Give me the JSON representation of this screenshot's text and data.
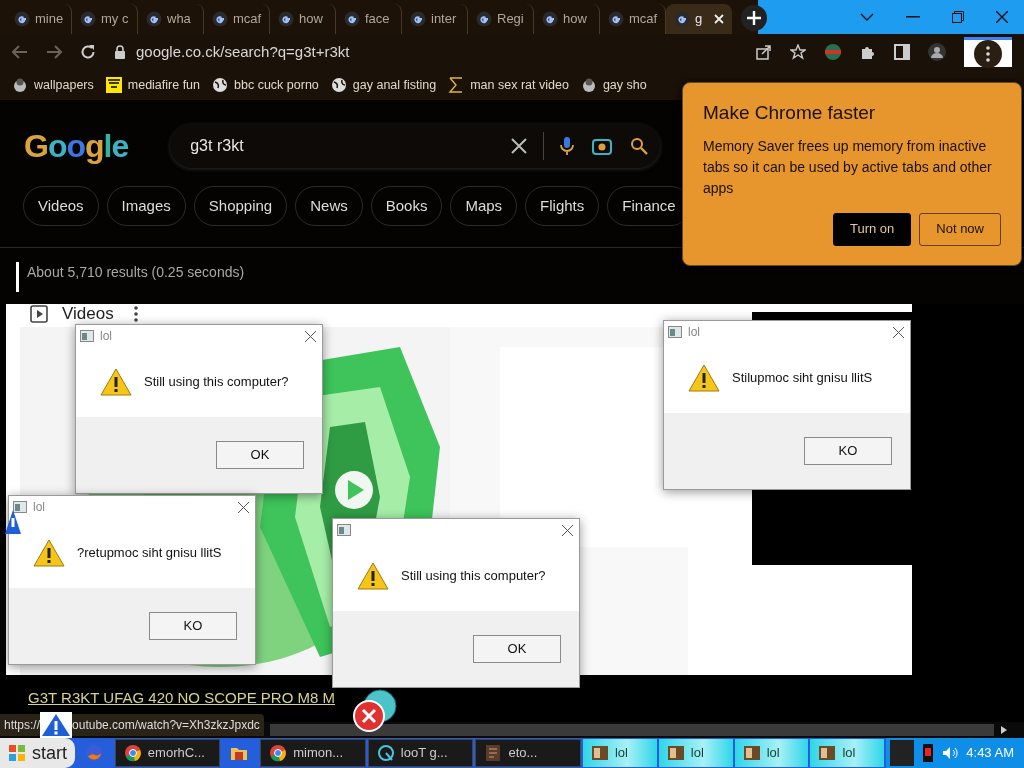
{
  "tabs": [
    {
      "label": "mine",
      "selected": false
    },
    {
      "label": "my c",
      "selected": false
    },
    {
      "label": "wha",
      "selected": false
    },
    {
      "label": "mcaf",
      "selected": false
    },
    {
      "label": "how",
      "selected": false
    },
    {
      "label": "face",
      "selected": false
    },
    {
      "label": "inter",
      "selected": false
    },
    {
      "label": "Regi",
      "selected": false
    },
    {
      "label": "how",
      "selected": false
    },
    {
      "label": "mcaf",
      "selected": false
    },
    {
      "label": "g",
      "selected": true
    }
  ],
  "address_bar": {
    "url": "google.co.ck/search?q=g3t+r3kt"
  },
  "bookmarks": [
    {
      "label": "wallpapers",
      "kind": "mascot"
    },
    {
      "label": "mediafire fun",
      "kind": "mf"
    },
    {
      "label": "bbc cuck porno",
      "kind": "globe"
    },
    {
      "label": "gay anal fisting",
      "kind": "globe"
    },
    {
      "label": "man sex rat video",
      "kind": "sigma"
    },
    {
      "label": "gay sho",
      "kind": "mascot"
    }
  ],
  "logo": "Google",
  "search": {
    "query": "g3t r3kt"
  },
  "filter_chips": [
    "Videos",
    "Images",
    "Shopping",
    "News",
    "Books",
    "Maps",
    "Flights",
    "Finance"
  ],
  "result_stats": "About 5,710 results (0.25 seconds)",
  "promo": {
    "title": "Make Chrome faster",
    "body": "Memory Saver frees up memory from inactive tabs so it can be used by active tabs and other apps",
    "buttons": [
      "Turn on",
      "Not now"
    ]
  },
  "videos": {
    "heading": "Videos",
    "result_title": "G3T R3KT UFAG 420 NO SCOPE PRO M8 M"
  },
  "status_url": [
    "https://",
    "outube.com/watch?v=Xh3zkzJpxdc"
  ],
  "dialogs": [
    {
      "title": "lol",
      "message": "Still using this computer?",
      "button": "OK"
    },
    {
      "title": "lol",
      "message": "Stilupmoc siht gnisu llitS",
      "button": "KO"
    },
    {
      "title": "lol",
      "message": "?retupmoc siht gnisu llitS",
      "button": "KO"
    },
    {
      "message": "Still using this computer?",
      "button": "OK"
    }
  ],
  "taskbar": {
    "start": "start",
    "items": [
      {
        "kind": "firefox"
      },
      {
        "kind": "chrome",
        "label": "emorhC..."
      },
      {
        "kind": "folder"
      },
      {
        "kind": "chrome",
        "label": "mimon..."
      },
      {
        "kind": "tool",
        "label": "looT g..."
      },
      {
        "kind": "note",
        "label": "eto..."
      },
      {
        "kind": "lol",
        "label": "lol"
      },
      {
        "kind": "lol",
        "label": "lol"
      },
      {
        "kind": "lol",
        "label": "lol"
      },
      {
        "kind": "lol",
        "label": "lol"
      }
    ],
    "clock": "4:43 AM"
  }
}
